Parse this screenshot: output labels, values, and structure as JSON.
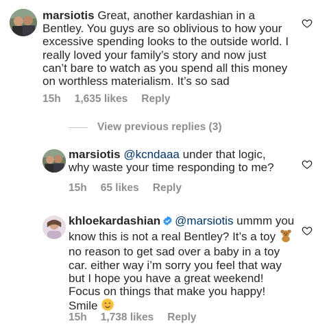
{
  "comments": [
    {
      "username": "marsiotis",
      "text": "Great, another kardashian in a Bentley. You guys are so oblivious to how your excessive spending looks to the outside world. I really loved your family’s story and now just can’t bare to watch as you spend all this money on worthless materialism. It’s so sad",
      "time": "15h",
      "likes": "1,635 likes",
      "reply_label": "Reply"
    },
    {
      "username": "marsiotis",
      "mention": "@kcndaaa",
      "text": "under that logic, why waste your time responding to me?",
      "time": "15h",
      "likes": "65 likes",
      "reply_label": "Reply"
    },
    {
      "username": "khloekardashian",
      "mention": "@marsiotis",
      "text_a": "ummm you know this is not a real Bentley? It’s a toy",
      "text_b": "no reason to get sad over a baby in a toy car. either way i’m sorry you feel that way but I hope you have a great weekend! Focus on things that make you happy! Smile",
      "time": "15h",
      "likes": "1,738 likes",
      "reply_label": "Reply"
    }
  ],
  "view_previous_replies": "View previous replies (3)",
  "colors": {
    "verified": "#3897f0",
    "mention": "#003569",
    "meta": "#8e8e8e"
  },
  "icons": [
    "heart-icon",
    "verified-badge-icon",
    "teddy-bear-emoji",
    "smiling-face-emoji"
  ]
}
